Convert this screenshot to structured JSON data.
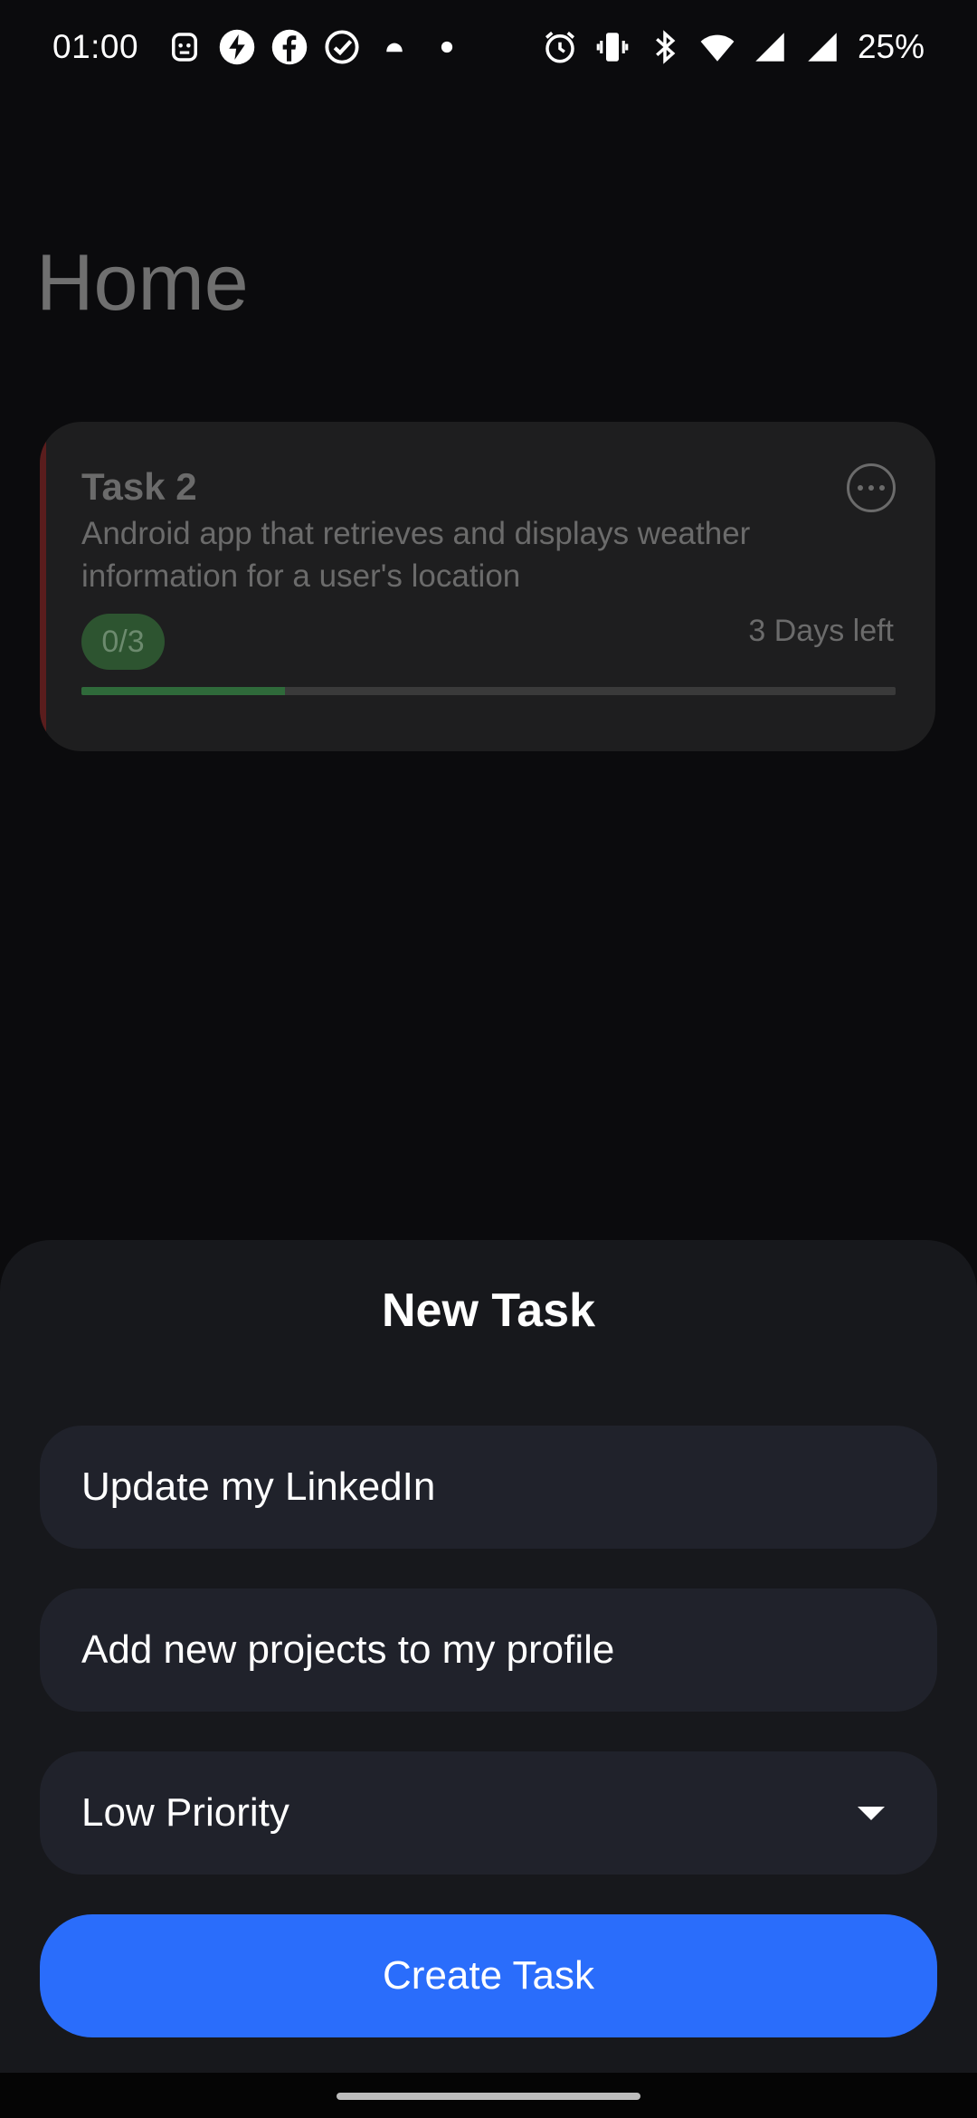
{
  "status_bar": {
    "time": "01:00",
    "battery": "25%",
    "left_icons": [
      "robot-icon",
      "power-icon",
      "facebook-icon",
      "check-circle-icon",
      "cloud-icon",
      "dot-icon"
    ],
    "right_icons": [
      "alarm-icon",
      "vibrate-icon",
      "bluetooth-icon",
      "wifi-icon",
      "signal-icon",
      "signal-icon"
    ]
  },
  "page": {
    "title": "Home"
  },
  "task_card": {
    "title": "Task 2",
    "description": "Android app that retrieves and displays weather information for a user's location",
    "progress_text": "0/3",
    "days_left": "3 Days left",
    "progress_fraction": 0.25
  },
  "sheet": {
    "title": "New Task",
    "task_title_value": "Update my LinkedIn",
    "task_description_value": "Add new projects to my profile",
    "priority_selected": "Low Priority",
    "create_label": "Create Task"
  },
  "colors": {
    "accent": "#2a6dfb",
    "sheet_bg": "#17181c",
    "field_bg": "#20222b",
    "progress_green": "#2f6a3a"
  }
}
